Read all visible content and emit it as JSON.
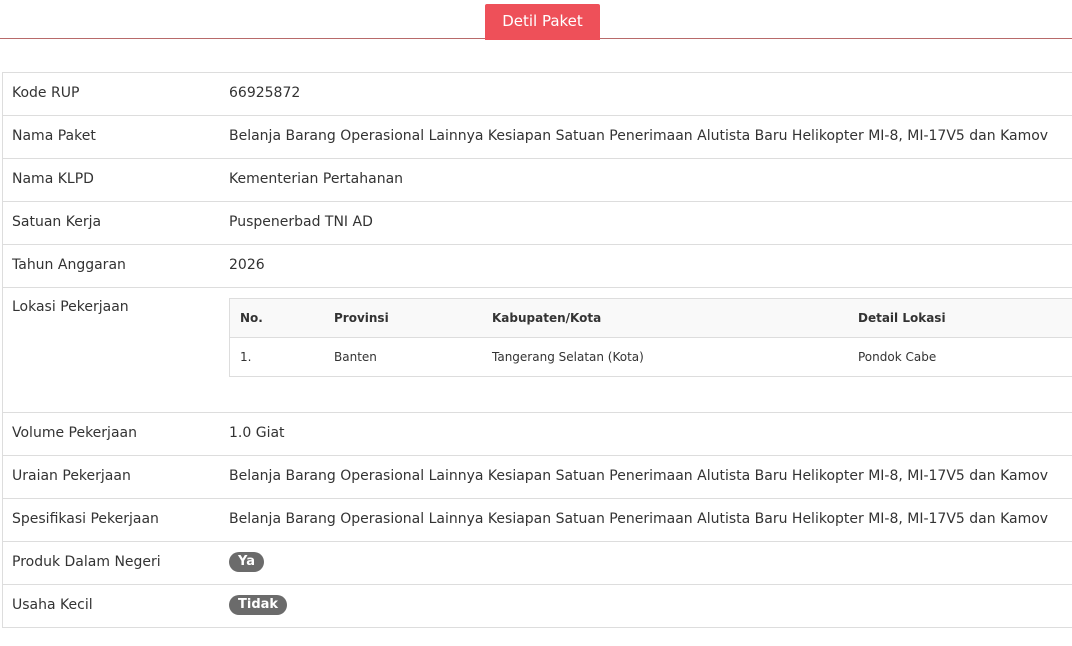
{
  "tab": {
    "label": "Detil Paket"
  },
  "fields": {
    "kode_rup": {
      "label": "Kode RUP",
      "value": "66925872"
    },
    "nama_paket": {
      "label": "Nama Paket",
      "value": "Belanja Barang Operasional Lainnya Kesiapan Satuan Penerimaan Alutista Baru Helikopter MI-8, MI-17V5 dan Kamov"
    },
    "nama_klpd": {
      "label": "Nama KLPD",
      "value": "Kementerian Pertahanan"
    },
    "satuan_kerja": {
      "label": "Satuan Kerja",
      "value": "Puspenerbad TNI AD"
    },
    "tahun_anggaran": {
      "label": "Tahun Anggaran",
      "value": "2026"
    },
    "lokasi_pekerjaan": {
      "label": "Lokasi Pekerjaan",
      "headers": {
        "no": "No.",
        "provinsi": "Provinsi",
        "kabupaten": "Kabupaten/Kota",
        "detail": "Detail Lokasi"
      },
      "rows": [
        {
          "no": "1.",
          "provinsi": "Banten",
          "kabupaten": "Tangerang Selatan (Kota)",
          "detail": "Pondok Cabe"
        }
      ]
    },
    "volume_pekerjaan": {
      "label": "Volume Pekerjaan",
      "value": "1.0 Giat"
    },
    "uraian_pekerjaan": {
      "label": "Uraian Pekerjaan",
      "value": "Belanja Barang Operasional Lainnya Kesiapan Satuan Penerimaan Alutista Baru Helikopter MI-8, MI-17V5 dan Kamov"
    },
    "spesifikasi_pekerjaan": {
      "label": "Spesifikasi Pekerjaan",
      "value": "Belanja Barang Operasional Lainnya Kesiapan Satuan Penerimaan Alutista Baru Helikopter MI-8, MI-17V5 dan Kamov"
    },
    "produk_dalam_negeri": {
      "label": "Produk Dalam Negeri",
      "value": "Ya"
    },
    "usaha_kecil": {
      "label": "Usaha Kecil",
      "value": "Tidak"
    }
  },
  "colors": {
    "tab_accent": "#ee5059",
    "badge": "#6b6b6b",
    "border": "#dddddd"
  }
}
